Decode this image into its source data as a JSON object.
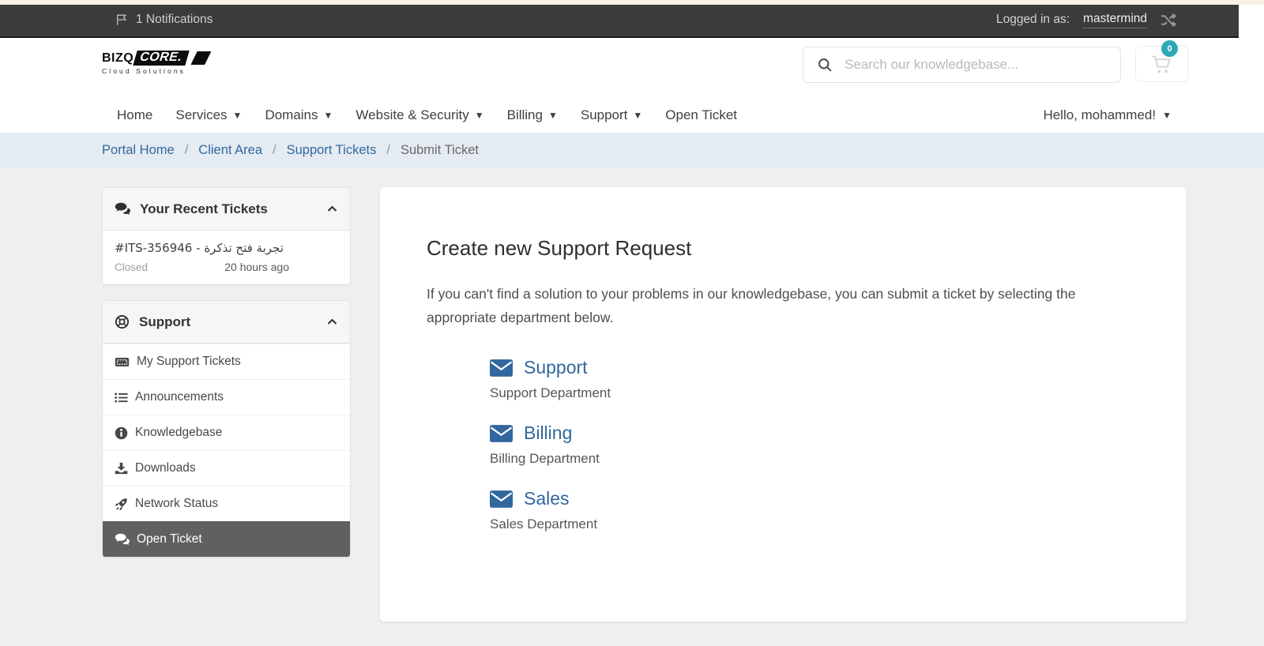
{
  "topbar": {
    "notifications_label": "1 Notifications",
    "logged_in_as_label": "Logged in as:",
    "username": "mastermind"
  },
  "header": {
    "logo_primary": "BIZQ",
    "logo_secondary": "CORE.",
    "logo_tagline": "Cloud Solutions",
    "search_placeholder": "Search our knowledgebase...",
    "cart_count": "0"
  },
  "nav": {
    "items": [
      {
        "label": "Home",
        "has_caret": false
      },
      {
        "label": "Services",
        "has_caret": true
      },
      {
        "label": "Domains",
        "has_caret": true
      },
      {
        "label": "Website & Security",
        "has_caret": true
      },
      {
        "label": "Billing",
        "has_caret": true
      },
      {
        "label": "Support",
        "has_caret": true
      },
      {
        "label": "Open Ticket",
        "has_caret": false
      }
    ],
    "greeting": "Hello, mohammed!"
  },
  "breadcrumb": {
    "links": [
      "Portal Home",
      "Client Area",
      "Support Tickets"
    ],
    "current": "Submit Ticket",
    "separator": "/"
  },
  "sidebar": {
    "recent_tickets": {
      "title": "Your Recent Tickets",
      "ticket": {
        "title": "#ITS-356946 - تجربة فتح تذكرة",
        "status": "Closed",
        "time": "20 hours ago"
      }
    },
    "support_panel": {
      "title": "Support",
      "items": [
        {
          "label": "My Support Tickets",
          "icon": "ticket-icon",
          "active": false
        },
        {
          "label": "Announcements",
          "icon": "list-icon",
          "active": false
        },
        {
          "label": "Knowledgebase",
          "icon": "info-circle-icon",
          "active": false
        },
        {
          "label": "Downloads",
          "icon": "download-icon",
          "active": false
        },
        {
          "label": "Network Status",
          "icon": "rocket-icon",
          "active": false
        },
        {
          "label": "Open Ticket",
          "icon": "comments-icon",
          "active": true
        }
      ]
    }
  },
  "main": {
    "title": "Create new Support Request",
    "description": "If you can't find a solution to your problems in our knowledgebase, you can submit a ticket by selecting the appropriate department below.",
    "departments": [
      {
        "name": "Support",
        "description": "Support Department"
      },
      {
        "name": "Billing",
        "description": "Billing Department"
      },
      {
        "name": "Sales",
        "description": "Sales Department"
      }
    ]
  },
  "colors": {
    "accent_blue": "#31679d",
    "badge_teal": "#2fa8b5",
    "topbar_bg": "#3b3b3b",
    "active_item_bg": "#606060",
    "breadcrumb_bg": "#e4ebf2",
    "body_bg": "#efefef"
  }
}
